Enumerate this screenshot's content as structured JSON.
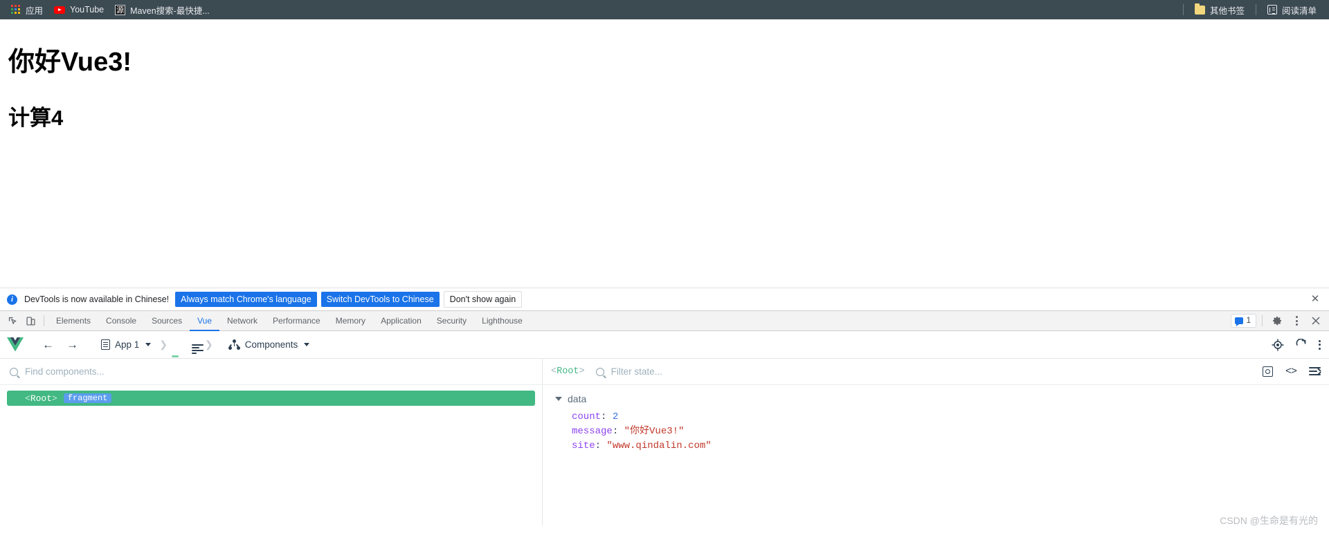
{
  "browser": {
    "bookmarks": [
      {
        "label": "应用",
        "icon": "apps-grid-icon"
      },
      {
        "label": "YouTube",
        "icon": "youtube-icon"
      },
      {
        "label": "Maven搜索-最快捷...",
        "icon": "maven-icon",
        "icon_text": "源"
      }
    ],
    "right_items": [
      {
        "label": "其他书签",
        "icon": "folder-icon"
      },
      {
        "label": "阅读清单",
        "icon": "reading-list-icon"
      }
    ],
    "bar_color": "#3c4a52"
  },
  "page": {
    "heading": "你好Vue3!",
    "subheading": "计算4"
  },
  "notice": {
    "icon": "info-icon",
    "text": "DevTools is now available in Chinese!",
    "primary_button": "Always match Chrome's language",
    "secondary_button": "Switch DevTools to Chinese",
    "dismiss_button": "Don't show again",
    "close_icon": "close-icon",
    "accent": "#1a73e8"
  },
  "devtools": {
    "left_icons": [
      "inspect-element-icon",
      "device-toolbar-icon"
    ],
    "tabs": [
      "Elements",
      "Console",
      "Sources",
      "Vue",
      "Network",
      "Performance",
      "Memory",
      "Application",
      "Security",
      "Lighthouse"
    ],
    "active_tab": "Vue",
    "message_count": "1",
    "right_icons": [
      "message-badge",
      "settings-gear-icon",
      "more-options-icon",
      "close-devtools-icon"
    ]
  },
  "vue_toolbar": {
    "logo": "vue-logo-icon",
    "back_icon": "back-arrow-icon",
    "forward_icon": "forward-arrow-icon",
    "app_selector": "App 1",
    "app_icon": "document-icon",
    "route_icon": "compass-icon",
    "timeline_icon": "timeline-icon",
    "panel_selector": "Components",
    "panel_icon": "component-tree-icon",
    "right_icons": [
      "target-select-icon",
      "refresh-icon",
      "more-options-icon"
    ],
    "accent": "#42b883"
  },
  "components_pane": {
    "search_placeholder": "Find components...",
    "search_value": "",
    "search_icon": "search-icon",
    "tree": [
      {
        "name": "Root",
        "open_angle": "<",
        "close_angle": ">",
        "tag": "fragment",
        "selected": true
      }
    ]
  },
  "state_pane": {
    "root_label": "Root",
    "open_angle": "<",
    "close_angle": ">",
    "filter_placeholder": "Filter state...",
    "filter_value": "",
    "search_icon": "search-icon",
    "icons": [
      "inspect-in-page-icon",
      "open-in-editor-icon",
      "collapse-all-icon"
    ],
    "groups": [
      {
        "name": "data",
        "expanded": true,
        "entries": [
          {
            "key": "count",
            "value": "2",
            "type": "number"
          },
          {
            "key": "message",
            "value": "\"你好Vue3!\"",
            "type": "string"
          },
          {
            "key": "site",
            "value": "\"www.qindalin.com\"",
            "type": "string"
          }
        ]
      }
    ]
  },
  "watermark": "CSDN @生命是有光的"
}
